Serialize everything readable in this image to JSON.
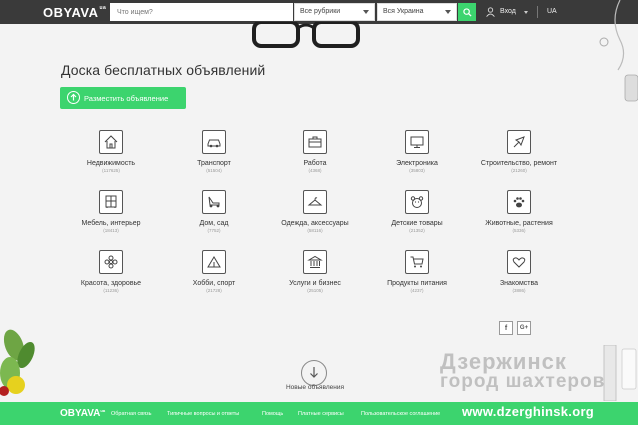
{
  "header": {
    "logo": "OBYAVA",
    "logo_suffix": "ua",
    "search_placeholder": "Что ищем?",
    "rubric_select": "Все рубрики",
    "region_select": "Вся Украина",
    "login": "Вход",
    "language": "UA"
  },
  "main": {
    "title": "Доска бесплатных объявлений",
    "post_button": "Разместить объявление",
    "categories": [
      {
        "name": "Недвижимость",
        "count": "(117625)",
        "icon": "house-icon"
      },
      {
        "name": "Транспорт",
        "count": "(51504)",
        "icon": "car-icon"
      },
      {
        "name": "Работа",
        "count": "(4368)",
        "icon": "briefcase-icon"
      },
      {
        "name": "Электроника",
        "count": "(35803)",
        "icon": "monitor-icon"
      },
      {
        "name": "Строительство, ремонт",
        "count": "(21260)",
        "icon": "trowel-icon"
      },
      {
        "name": "Мебель, интерьер",
        "count": "(18413)",
        "icon": "wardrobe-icon"
      },
      {
        "name": "Дом, сад",
        "count": "(7752)",
        "icon": "lawnmower-icon"
      },
      {
        "name": "Одежда, аксессуары",
        "count": "(58116)",
        "icon": "hanger-icon"
      },
      {
        "name": "Детские товары",
        "count": "(21352)",
        "icon": "teddy-bear-icon"
      },
      {
        "name": "Животные, растения",
        "count": "(5336)",
        "icon": "paw-icon"
      },
      {
        "name": "Красота, здоровье",
        "count": "(11236)",
        "icon": "flower-icon"
      },
      {
        "name": "Хобби, спорт",
        "count": "(21728)",
        "icon": "tent-icon"
      },
      {
        "name": "Услуги и бизнес",
        "count": "(25105)",
        "icon": "bank-icon"
      },
      {
        "name": "Продукты питания",
        "count": "(4237)",
        "icon": "cart-icon"
      },
      {
        "name": "Знакомства",
        "count": "(3886)",
        "icon": "hearts-icon"
      }
    ],
    "social": [
      "f",
      "G+"
    ],
    "new_ads": "Новые объявления"
  },
  "footer": {
    "logo": "OBYAVA",
    "logo_suffix": "ua",
    "links": [
      "Обратная связь",
      "Типичные вопросы и ответы",
      "Помощь",
      "Платные сервисы",
      "Пользовательское соглашение"
    ]
  },
  "watermark": {
    "line1": "Дзержинск",
    "line2": "город шахтеров",
    "url": "www.dzerghinsk.org"
  },
  "colors": {
    "accent": "#3cd46e",
    "header_bg": "#3a3a3a",
    "page_bg": "#f3f3f3"
  }
}
